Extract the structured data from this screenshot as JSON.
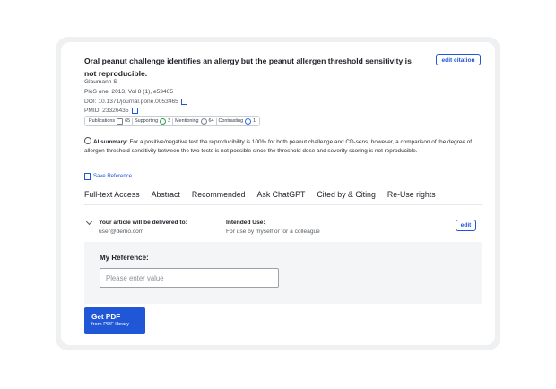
{
  "article": {
    "title": "Oral peanut challenge identifies an allergy but the peanut allergen threshold sensitivity is not reproducible.",
    "author": "Glaumann S",
    "journal": "PloS one, 2013, Vol 8 (1), e53465",
    "doi": "DOI: 10.1371/journal.pone.0053465",
    "pmid": "PMID: 23326435"
  },
  "edit_citation_label": "edit citation",
  "badges": [
    {
      "label": "Publications",
      "count": "65",
      "icon": "document-icon"
    },
    {
      "label": "Supporting",
      "count": "2",
      "icon": "check-circle-icon"
    },
    {
      "label": "Mentioning",
      "count": "64",
      "icon": "mention-icon"
    },
    {
      "label": "Contrasting",
      "count": "1",
      "icon": "contrast-icon"
    }
  ],
  "ai_summary": {
    "label": "AI summary:",
    "text": "For a positive/negative test the reproducibility is 100% for both peanut challenge and CD-sens, however, a comparison of the degree of allergen threshold sensitivity between the two tests is not possible since the threshold dose and severity scoring is not reproducible."
  },
  "save_reference_label": "Save Reference",
  "tabs": [
    "Full-text Access",
    "Abstract",
    "Recommended",
    "Ask ChatGPT",
    "Cited by & Citing",
    "Re-Use rights"
  ],
  "delivery": {
    "heading": "Your article will be delivered to:",
    "email": "user@demo.com",
    "intended_heading": "Intended Use:",
    "intended_value": "For use by myself or for a colleague",
    "edit_label": "edit"
  },
  "my_reference": {
    "label": "My Reference:",
    "placeholder": "Please enter value"
  },
  "get_pdf": {
    "title": "Get PDF",
    "subtitle": "from PDF library"
  },
  "colors": {
    "accent": "#1f57d6",
    "frame": "#eef0f2",
    "panel": "#f4f5f6"
  }
}
